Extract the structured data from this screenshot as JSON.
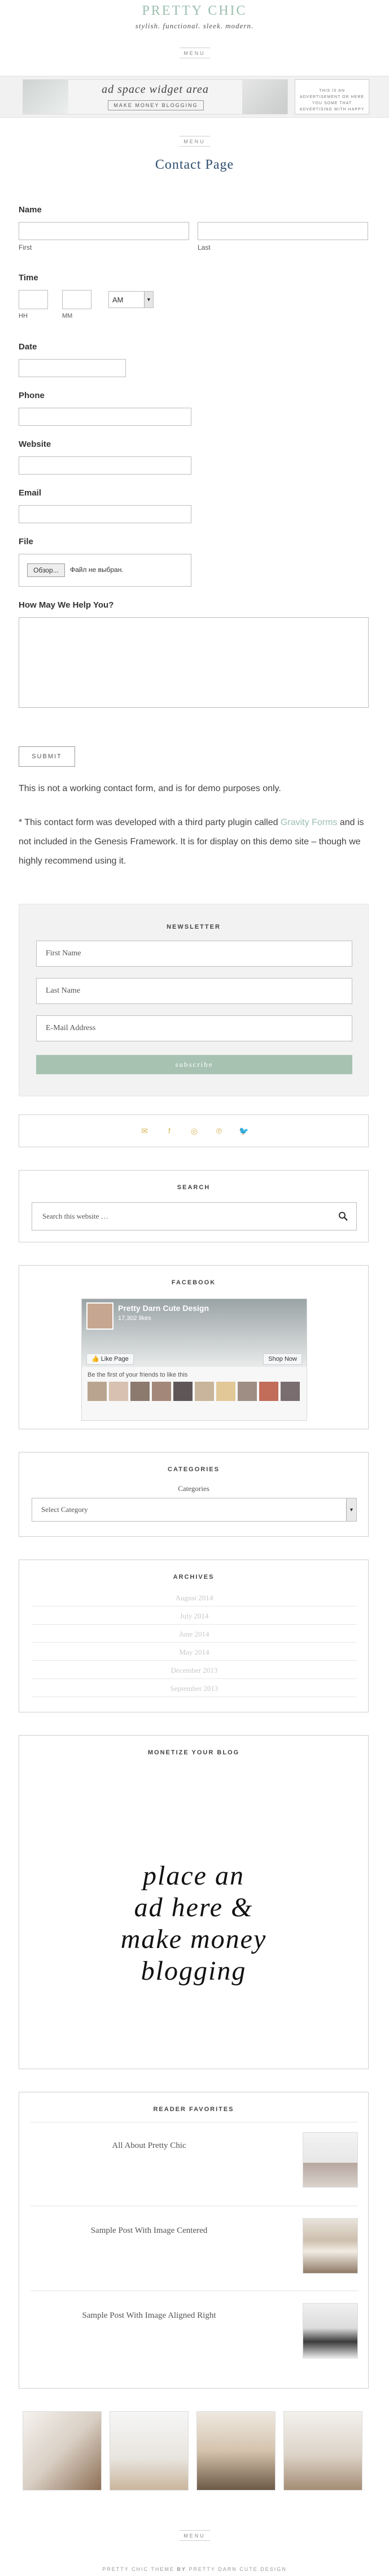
{
  "header": {
    "title": "PRETTY CHIC",
    "description": "stylish. functional. sleek. modern.",
    "menu_label": "MENU"
  },
  "banner": {
    "script": "ad space widget area",
    "tag": "MAKE MONEY BLOGGING",
    "side_ad": "THIS IS AN ADVERTISEMENT OR HERE YOU SOME THAT ADVERTISING WITH HAPPY"
  },
  "secondary_menu_label": "MENU",
  "page_title": "Contact Page",
  "form": {
    "name_label": "Name",
    "first_sub": "First",
    "last_sub": "Last",
    "time_label": "Time",
    "hh_sub": "HH",
    "mm_sub": "MM",
    "ampm_value": "AM",
    "date_label": "Date",
    "phone_label": "Phone",
    "website_label": "Website",
    "email_label": "Email",
    "file_label": "File",
    "file_button": "Обзор...",
    "file_status": "Файл не выбран.",
    "message_label": "How May We Help You?",
    "submit_label": "SUBMIT"
  },
  "notes": {
    "note1": "This is not a working contact form, and is for demo purposes only.",
    "note2_pre": "* This contact form was developed with a third party plugin called ",
    "note2_link": "Gravity Forms",
    "note2_post": " and is not included in the Genesis Framework. It is for display on this demo site – though we highly recommend using it."
  },
  "newsletter": {
    "title": "NEWSLETTER",
    "first_placeholder": "First Name",
    "last_placeholder": "Last Name",
    "email_placeholder": "E-Mail Address",
    "button": "subscribe"
  },
  "social_icons": [
    "email-icon",
    "facebook-icon",
    "instagram-icon",
    "pinterest-icon",
    "twitter-icon"
  ],
  "social_glyphs": [
    "✉",
    "f",
    "◎",
    "℗",
    "🐦"
  ],
  "search": {
    "title": "SEARCH",
    "placeholder": "Search this website …"
  },
  "facebook": {
    "title": "FACEBOOK",
    "page_name": "Pretty Darn Cute Design",
    "likes": "17,302 likes",
    "like_button": "Like Page",
    "shop_button": "Shop Now",
    "friends_text": "Be the first of your friends to like this"
  },
  "categories": {
    "title": "CATEGORIES",
    "sublabel": "Categories",
    "select_value": "Select Category"
  },
  "archives": {
    "title": "ARCHIVES",
    "items": [
      "August 2014",
      "July 2014",
      "June 2014",
      "May 2014",
      "December 2013",
      "September 2013"
    ]
  },
  "monetize": {
    "title": "MONETIZE YOUR BLOG",
    "line1": "place an",
    "line2": "ad here &",
    "line3": "make money",
    "line4": "blogging"
  },
  "favorites": {
    "title": "READER FAVORITES",
    "items": [
      "All About Pretty Chic",
      "Sample Post With Image Centered",
      "Sample Post With Image Aligned Right"
    ]
  },
  "footer": {
    "menu_label": "MENU",
    "text_pre": "PRETTY CHIC THEME ",
    "text_by": "BY",
    "text_post": " PRETTY DARN CUTE DESIGN"
  },
  "colors": {
    "accent": "#9cbfaf",
    "button": "#a7c2b1",
    "title_blue": "#2e4f6e",
    "social": "#d9b45a"
  }
}
